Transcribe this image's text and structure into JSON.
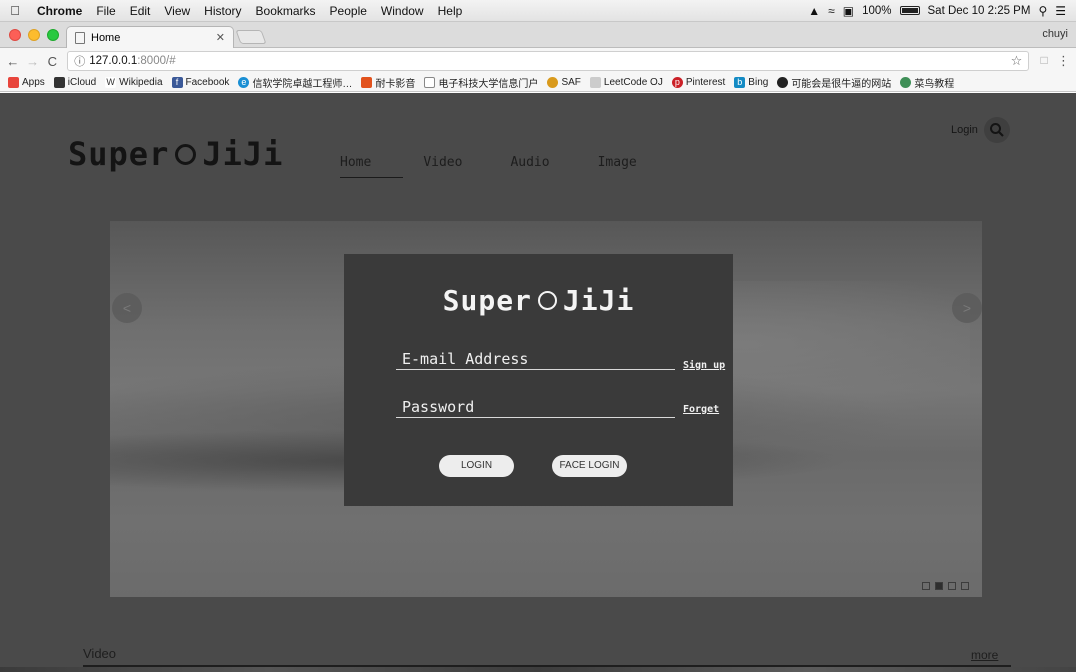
{
  "menubar": {
    "app_name": "Chrome",
    "items": [
      "File",
      "Edit",
      "View",
      "History",
      "Bookmarks",
      "People",
      "Window",
      "Help"
    ],
    "battery_percent": "100%",
    "battery_level": 1.0,
    "clock": "Sat Dec 10  2:25 PM"
  },
  "browser": {
    "tab_title": "Home",
    "profile_name": "chuyi",
    "url_host": "127.0.0.1",
    "url_rest": ":8000/#",
    "bookmarks": [
      {
        "label": "Apps",
        "icon": "apps-grid-icon",
        "color": "#e8453c"
      },
      {
        "label": "iCloud",
        "icon": "apple-icon",
        "color": "#333333"
      },
      {
        "label": "Wikipedia",
        "icon": "wikipedia-icon",
        "color": "#555555"
      },
      {
        "label": "Facebook",
        "icon": "facebook-icon",
        "color": "#3b5998"
      },
      {
        "label": "信软学院卓越工程师…",
        "icon": "edge-icon",
        "color": "#1a8fd4"
      },
      {
        "label": "耐卡影音",
        "icon": "media-icon",
        "color": "#e2521d"
      },
      {
        "label": "电子科技大学信息门户",
        "icon": "page-icon",
        "color": "#888888"
      },
      {
        "label": "SAF",
        "icon": "saf-icon",
        "color": "#d99a1c"
      },
      {
        "label": "LeetCode OJ",
        "icon": "leetcode-icon",
        "color": "#cccccc"
      },
      {
        "label": "Pinterest",
        "icon": "pinterest-icon",
        "color": "#cb2027"
      },
      {
        "label": "Bing",
        "icon": "bing-icon",
        "color": "#148bc4"
      },
      {
        "label": "可能会是很牛逼的网站",
        "icon": "github-icon",
        "color": "#222222"
      },
      {
        "label": "菜鸟教程",
        "icon": "runoob-icon",
        "color": "#3f8f57"
      }
    ]
  },
  "site": {
    "logo_left": "Super",
    "logo_right": "JiJi",
    "nav": [
      "Home",
      "Video",
      "Audio",
      "Image"
    ],
    "login_label": "Login",
    "section_title": "Video",
    "more_label": "more"
  },
  "modal": {
    "logo_left": "Super",
    "logo_right": "JiJi",
    "email_placeholder": "E-mail Address",
    "password_placeholder": "Password",
    "signup_label": "Sign up",
    "forget_label": "Forget",
    "login_button": "LOGIN",
    "face_login_button": "FACE LOGIN"
  },
  "carousel": {
    "prev_glyph": "<",
    "next_glyph": ">",
    "slide_count": 4,
    "active_slide": 2
  }
}
